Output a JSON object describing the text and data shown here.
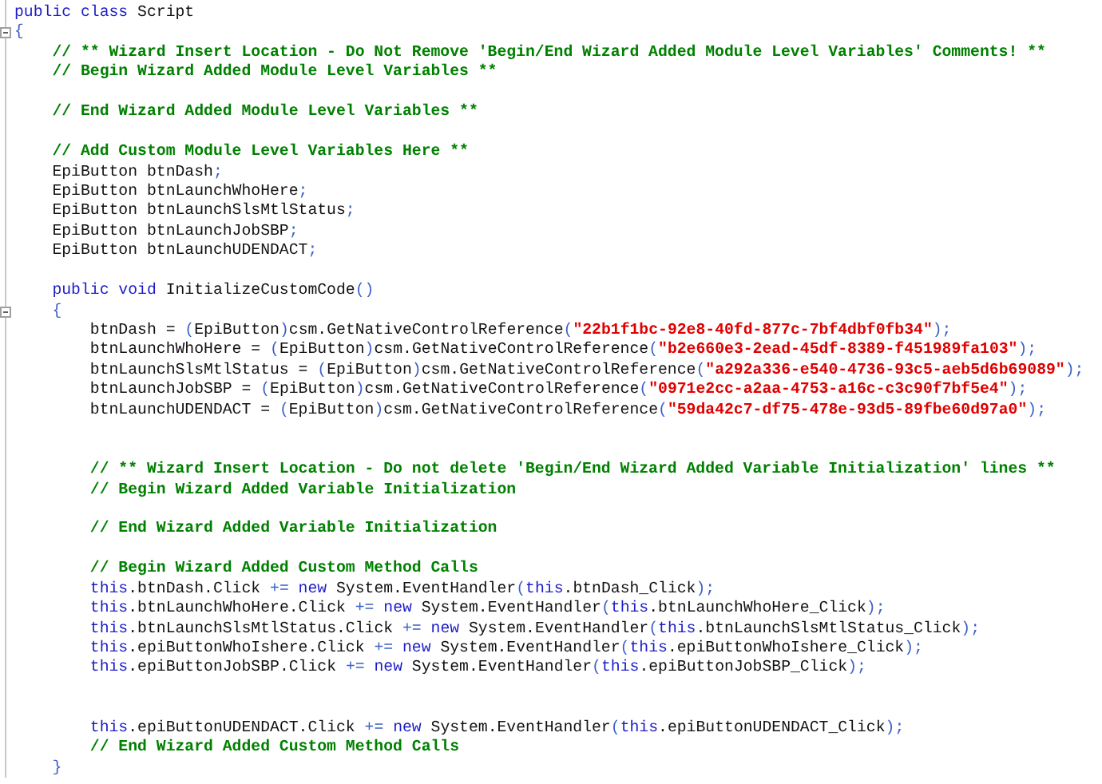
{
  "editor": {
    "lines": [
      {
        "kind": "code",
        "tokens": [
          {
            "kind": "keyword",
            "text": "public class"
          },
          {
            "kind": "plain",
            "text": " Script"
          }
        ]
      },
      {
        "kind": "fold-open",
        "tokens": [
          {
            "kind": "op",
            "text": "{"
          }
        ]
      },
      {
        "kind": "code",
        "tokens": [
          {
            "kind": "comment",
            "text": "    // ** Wizard Insert Location - Do Not Remove 'Begin/End Wizard Added Module Level Variables' Comments! **"
          }
        ]
      },
      {
        "kind": "code",
        "tokens": [
          {
            "kind": "comment",
            "text": "    // Begin Wizard Added Module Level Variables **"
          }
        ]
      },
      {
        "kind": "blank"
      },
      {
        "kind": "code",
        "tokens": [
          {
            "kind": "comment",
            "text": "    // End Wizard Added Module Level Variables **"
          }
        ]
      },
      {
        "kind": "blank"
      },
      {
        "kind": "code",
        "tokens": [
          {
            "kind": "comment",
            "text": "    // Add Custom Module Level Variables Here **"
          }
        ]
      },
      {
        "kind": "code",
        "tokens": [
          {
            "kind": "plain",
            "text": "    EpiButton btnDash"
          },
          {
            "kind": "op",
            "text": ";"
          }
        ]
      },
      {
        "kind": "code",
        "tokens": [
          {
            "kind": "plain",
            "text": "    EpiButton btnLaunchWhoHere"
          },
          {
            "kind": "op",
            "text": ";"
          }
        ]
      },
      {
        "kind": "code",
        "tokens": [
          {
            "kind": "plain",
            "text": "    EpiButton btnLaunchSlsMtlStatus"
          },
          {
            "kind": "op",
            "text": ";"
          }
        ]
      },
      {
        "kind": "code",
        "tokens": [
          {
            "kind": "plain",
            "text": "    EpiButton btnLaunchJobSBP"
          },
          {
            "kind": "op",
            "text": ";"
          }
        ]
      },
      {
        "kind": "code",
        "tokens": [
          {
            "kind": "plain",
            "text": "    EpiButton btnLaunchUDENDACT"
          },
          {
            "kind": "op",
            "text": ";"
          }
        ]
      },
      {
        "kind": "blank"
      },
      {
        "kind": "code",
        "tokens": [
          {
            "kind": "keyword",
            "text": "    public void"
          },
          {
            "kind": "plain",
            "text": " InitializeCustomCode"
          },
          {
            "kind": "op",
            "text": "()"
          }
        ]
      },
      {
        "kind": "fold-open",
        "tokens": [
          {
            "kind": "op",
            "text": "    {"
          }
        ]
      },
      {
        "kind": "code",
        "tokens": [
          {
            "kind": "plain",
            "text": "        btnDash = "
          },
          {
            "kind": "op",
            "text": "("
          },
          {
            "kind": "plain",
            "text": "EpiButton"
          },
          {
            "kind": "op",
            "text": ")"
          },
          {
            "kind": "plain",
            "text": "csm.GetNativeControlReference"
          },
          {
            "kind": "op",
            "text": "("
          },
          {
            "kind": "string",
            "text": "\"22b1f1bc-92e8-40fd-877c-7bf4dbf0fb34\""
          },
          {
            "kind": "op",
            "text": ");"
          }
        ]
      },
      {
        "kind": "code",
        "tokens": [
          {
            "kind": "plain",
            "text": "        btnLaunchWhoHere = "
          },
          {
            "kind": "op",
            "text": "("
          },
          {
            "kind": "plain",
            "text": "EpiButton"
          },
          {
            "kind": "op",
            "text": ")"
          },
          {
            "kind": "plain",
            "text": "csm.GetNativeControlReference"
          },
          {
            "kind": "op",
            "text": "("
          },
          {
            "kind": "string",
            "text": "\"b2e660e3-2ead-45df-8389-f451989fa103\""
          },
          {
            "kind": "op",
            "text": ");"
          }
        ]
      },
      {
        "kind": "code",
        "tokens": [
          {
            "kind": "plain",
            "text": "        btnLaunchSlsMtlStatus = "
          },
          {
            "kind": "op",
            "text": "("
          },
          {
            "kind": "plain",
            "text": "EpiButton"
          },
          {
            "kind": "op",
            "text": ")"
          },
          {
            "kind": "plain",
            "text": "csm.GetNativeControlReference"
          },
          {
            "kind": "op",
            "text": "("
          },
          {
            "kind": "string",
            "text": "\"a292a336-e540-4736-93c5-aeb5d6b69089\""
          },
          {
            "kind": "op",
            "text": ");"
          }
        ]
      },
      {
        "kind": "code",
        "tokens": [
          {
            "kind": "plain",
            "text": "        btnLaunchJobSBP = "
          },
          {
            "kind": "op",
            "text": "("
          },
          {
            "kind": "plain",
            "text": "EpiButton"
          },
          {
            "kind": "op",
            "text": ")"
          },
          {
            "kind": "plain",
            "text": "csm.GetNativeControlReference"
          },
          {
            "kind": "op",
            "text": "("
          },
          {
            "kind": "string",
            "text": "\"0971e2cc-a2aa-4753-a16c-c3c90f7bf5e4\""
          },
          {
            "kind": "op",
            "text": ");"
          }
        ]
      },
      {
        "kind": "code",
        "tokens": [
          {
            "kind": "plain",
            "text": "        btnLaunchUDENDACT = "
          },
          {
            "kind": "op",
            "text": "("
          },
          {
            "kind": "plain",
            "text": "EpiButton"
          },
          {
            "kind": "op",
            "text": ")"
          },
          {
            "kind": "plain",
            "text": "csm.GetNativeControlReference"
          },
          {
            "kind": "op",
            "text": "("
          },
          {
            "kind": "string",
            "text": "\"59da42c7-df75-478e-93d5-89fbe60d97a0\""
          },
          {
            "kind": "op",
            "text": ");"
          }
        ]
      },
      {
        "kind": "blank"
      },
      {
        "kind": "blank"
      },
      {
        "kind": "code",
        "tokens": [
          {
            "kind": "comment",
            "text": "        // ** Wizard Insert Location - Do not delete 'Begin/End Wizard Added Variable Initialization' lines **"
          }
        ]
      },
      {
        "kind": "code",
        "tokens": [
          {
            "kind": "comment",
            "text": "        // Begin Wizard Added Variable Initialization"
          }
        ]
      },
      {
        "kind": "blank"
      },
      {
        "kind": "code",
        "tokens": [
          {
            "kind": "comment",
            "text": "        // End Wizard Added Variable Initialization"
          }
        ]
      },
      {
        "kind": "blank"
      },
      {
        "kind": "code",
        "tokens": [
          {
            "kind": "comment",
            "text": "        // Begin Wizard Added Custom Method Calls"
          }
        ]
      },
      {
        "kind": "code",
        "tokens": [
          {
            "kind": "keyword",
            "text": "        this"
          },
          {
            "kind": "plain",
            "text": ".btnDash.Click "
          },
          {
            "kind": "op",
            "text": "+= "
          },
          {
            "kind": "keyword",
            "text": "new"
          },
          {
            "kind": "plain",
            "text": " System.EventHandler"
          },
          {
            "kind": "op",
            "text": "("
          },
          {
            "kind": "keyword",
            "text": "this"
          },
          {
            "kind": "plain",
            "text": ".btnDash_Click"
          },
          {
            "kind": "op",
            "text": ");"
          }
        ]
      },
      {
        "kind": "code",
        "tokens": [
          {
            "kind": "keyword",
            "text": "        this"
          },
          {
            "kind": "plain",
            "text": ".btnLaunchWhoHere.Click "
          },
          {
            "kind": "op",
            "text": "+= "
          },
          {
            "kind": "keyword",
            "text": "new"
          },
          {
            "kind": "plain",
            "text": " System.EventHandler"
          },
          {
            "kind": "op",
            "text": "("
          },
          {
            "kind": "keyword",
            "text": "this"
          },
          {
            "kind": "plain",
            "text": ".btnLaunchWhoHere_Click"
          },
          {
            "kind": "op",
            "text": ");"
          }
        ]
      },
      {
        "kind": "code",
        "tokens": [
          {
            "kind": "keyword",
            "text": "        this"
          },
          {
            "kind": "plain",
            "text": ".btnLaunchSlsMtlStatus.Click "
          },
          {
            "kind": "op",
            "text": "+= "
          },
          {
            "kind": "keyword",
            "text": "new"
          },
          {
            "kind": "plain",
            "text": " System.EventHandler"
          },
          {
            "kind": "op",
            "text": "("
          },
          {
            "kind": "keyword",
            "text": "this"
          },
          {
            "kind": "plain",
            "text": ".btnLaunchSlsMtlStatus_Click"
          },
          {
            "kind": "op",
            "text": ");"
          }
        ]
      },
      {
        "kind": "code",
        "tokens": [
          {
            "kind": "keyword",
            "text": "        this"
          },
          {
            "kind": "plain",
            "text": ".epiButtonWhoIshere.Click "
          },
          {
            "kind": "op",
            "text": "+= "
          },
          {
            "kind": "keyword",
            "text": "new"
          },
          {
            "kind": "plain",
            "text": " System.EventHandler"
          },
          {
            "kind": "op",
            "text": "("
          },
          {
            "kind": "keyword",
            "text": "this"
          },
          {
            "kind": "plain",
            "text": ".epiButtonWhoIshere_Click"
          },
          {
            "kind": "op",
            "text": ");"
          }
        ]
      },
      {
        "kind": "code",
        "tokens": [
          {
            "kind": "keyword",
            "text": "        this"
          },
          {
            "kind": "plain",
            "text": ".epiButtonJobSBP.Click "
          },
          {
            "kind": "op",
            "text": "+= "
          },
          {
            "kind": "keyword",
            "text": "new"
          },
          {
            "kind": "plain",
            "text": " System.EventHandler"
          },
          {
            "kind": "op",
            "text": "("
          },
          {
            "kind": "keyword",
            "text": "this"
          },
          {
            "kind": "plain",
            "text": ".epiButtonJobSBP_Click"
          },
          {
            "kind": "op",
            "text": ");"
          }
        ]
      },
      {
        "kind": "blank"
      },
      {
        "kind": "blank"
      },
      {
        "kind": "code",
        "tokens": [
          {
            "kind": "keyword",
            "text": "        this"
          },
          {
            "kind": "plain",
            "text": ".epiButtonUDENDACT.Click "
          },
          {
            "kind": "op",
            "text": "+= "
          },
          {
            "kind": "keyword",
            "text": "new"
          },
          {
            "kind": "plain",
            "text": " System.EventHandler"
          },
          {
            "kind": "op",
            "text": "("
          },
          {
            "kind": "keyword",
            "text": "this"
          },
          {
            "kind": "plain",
            "text": ".epiButtonUDENDACT_Click"
          },
          {
            "kind": "op",
            "text": ");"
          }
        ]
      },
      {
        "kind": "code",
        "tokens": [
          {
            "kind": "comment",
            "text": "        // End Wizard Added Custom Method Calls"
          }
        ]
      },
      {
        "kind": "code",
        "tokens": [
          {
            "kind": "op",
            "text": "    }"
          }
        ]
      }
    ]
  }
}
